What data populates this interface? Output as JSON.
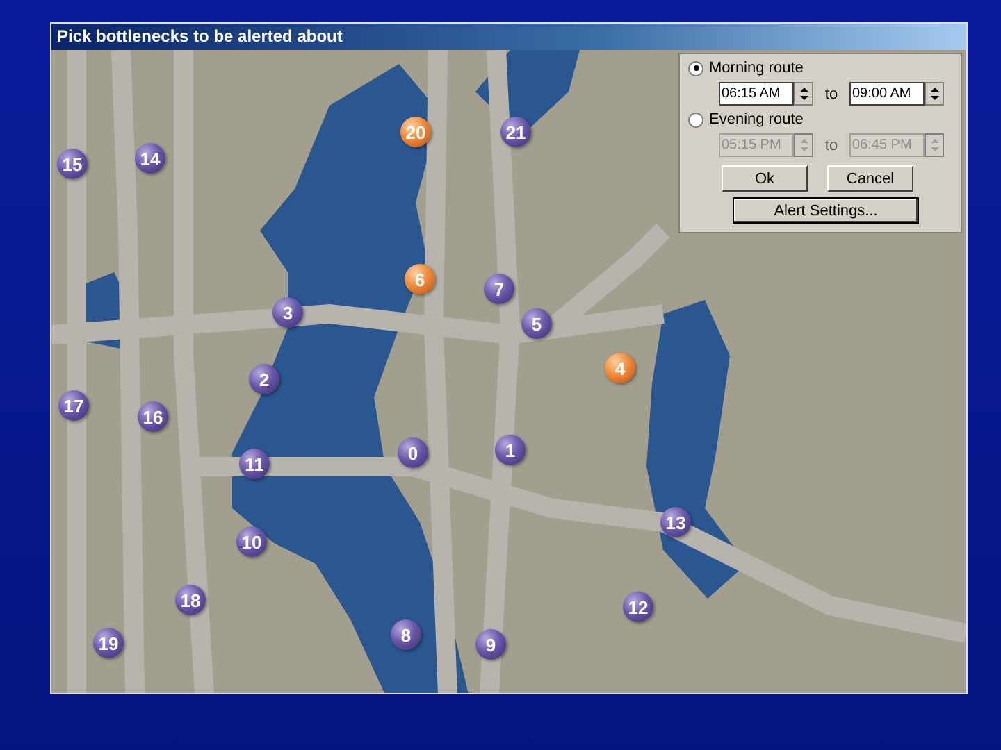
{
  "window": {
    "title": "Pick bottlenecks to be alerted about"
  },
  "pins": [
    {
      "label": "20",
      "selected": true
    },
    {
      "label": "21",
      "selected": false
    },
    {
      "label": "15",
      "selected": false
    },
    {
      "label": "14",
      "selected": false
    },
    {
      "label": "6",
      "selected": true
    },
    {
      "label": "7",
      "selected": false
    },
    {
      "label": "3",
      "selected": false
    },
    {
      "label": "5",
      "selected": false
    },
    {
      "label": "4",
      "selected": true
    },
    {
      "label": "2",
      "selected": false
    },
    {
      "label": "17",
      "selected": false
    },
    {
      "label": "16",
      "selected": false
    },
    {
      "label": "11",
      "selected": false
    },
    {
      "label": "0",
      "selected": false
    },
    {
      "label": "1",
      "selected": false
    },
    {
      "label": "13",
      "selected": false
    },
    {
      "label": "10",
      "selected": false
    },
    {
      "label": "18",
      "selected": false
    },
    {
      "label": "12",
      "selected": false
    },
    {
      "label": "19",
      "selected": false
    },
    {
      "label": "8",
      "selected": false
    },
    {
      "label": "9",
      "selected": false
    }
  ],
  "routes": [
    {
      "label": "Morning route",
      "selected": true,
      "disabled": false,
      "from": "06:15 AM",
      "separator": "to",
      "to": "09:00 AM"
    },
    {
      "label": "Evening route",
      "selected": false,
      "disabled": true,
      "from": "05:15 PM",
      "separator": "to",
      "to": "06:45 PM"
    }
  ],
  "buttons": [
    "Ok",
    "Cancel"
  ],
  "settings_button": "Alert Settings..."
}
